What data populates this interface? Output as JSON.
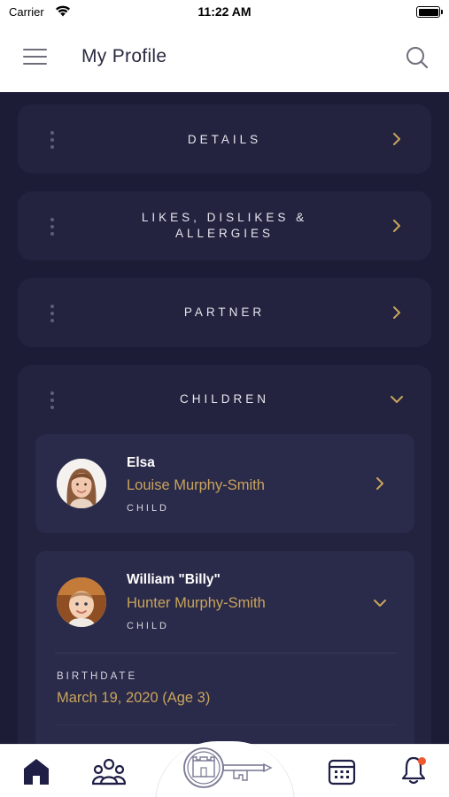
{
  "status_bar": {
    "carrier": "Carrier",
    "time": "11:22 AM"
  },
  "header": {
    "title": "My Profile"
  },
  "sections": [
    {
      "title": "DETAILS"
    },
    {
      "title_line1": "LIKES, DISLIKES &",
      "title_line2": "ALLERGIES"
    },
    {
      "title": "PARTNER"
    },
    {
      "title": "CHILDREN"
    }
  ],
  "children": [
    {
      "first_name": "Elsa",
      "rest_name": "Louise Murphy-Smith",
      "role": "CHILD",
      "expanded": false
    },
    {
      "first_name": "William \"Billy\"",
      "rest_name": "Hunter Murphy-Smith",
      "role": "CHILD",
      "expanded": true,
      "birthdate_label": "BIRTHDATE",
      "birthdate_value": "March 19, 2020 (Age 3)"
    }
  ],
  "tab_bar": {
    "tabs": [
      "home-icon",
      "people-icon",
      "castle-key-logo",
      "calendar-icon",
      "bell-icon"
    ],
    "active": "home-icon",
    "has_notification": true
  },
  "colors": {
    "background": "#1c1c36",
    "card": "#23233f",
    "accent_gold": "#c9a45c",
    "notification": "#f0582f",
    "active_tab": "#1e1e46"
  }
}
